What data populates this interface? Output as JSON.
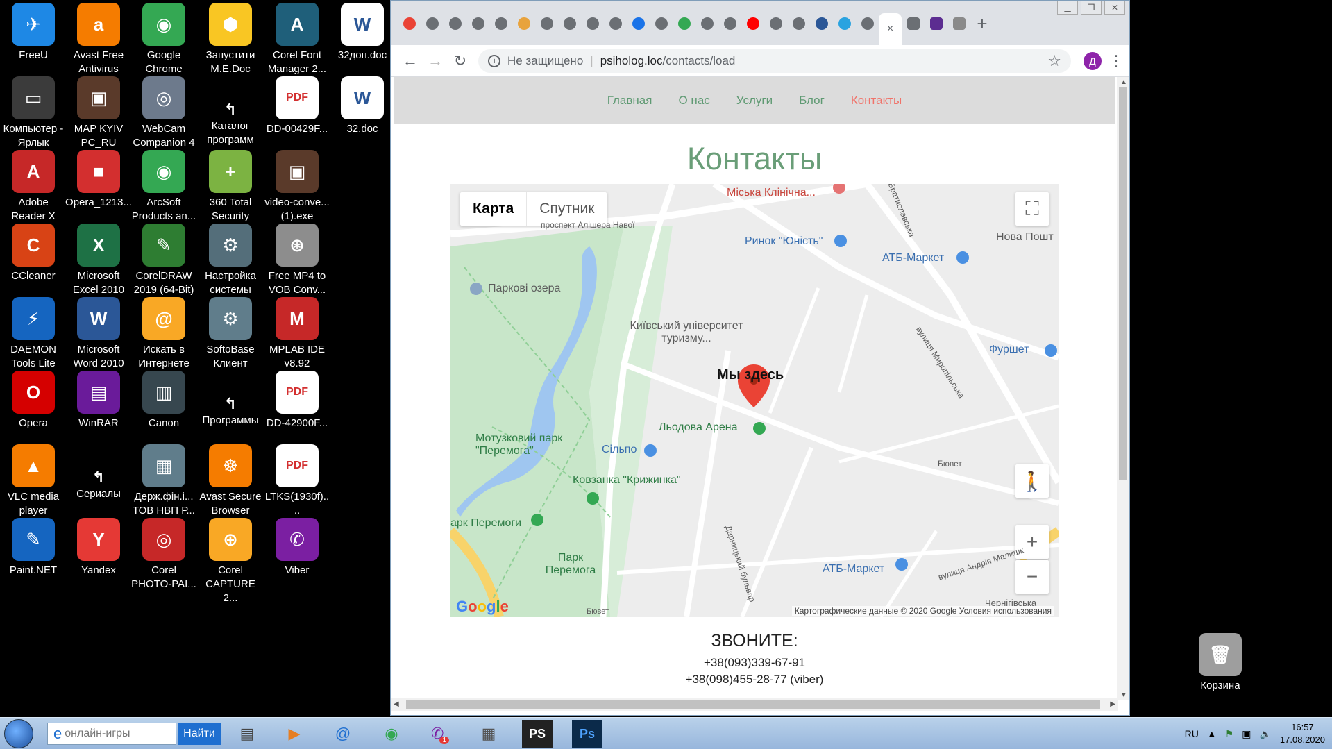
{
  "desktop": {
    "icons": [
      {
        "label": "FreeU",
        "name": "freeu-icon",
        "color": "#1e88e5",
        "glyph": "✈"
      },
      {
        "label": "Avast Free Antivirus",
        "name": "avast-icon",
        "color": "#f57c00",
        "glyph": "a"
      },
      {
        "label": "Google Chrome",
        "name": "chrome-icon",
        "color": "#34a853",
        "glyph": "◉"
      },
      {
        "label": "Запустити M.E.Doc",
        "name": "medoc-icon",
        "color": "#f9c623",
        "glyph": "⬢"
      },
      {
        "label": "Corel Font Manager 2...",
        "name": "corel-font-icon",
        "color": "#1f5f7a",
        "glyph": "A"
      },
      {
        "label": "32доп.doc",
        "name": "word-doc-icon",
        "color": "#2b5797",
        "glyph": "W"
      },
      {
        "label": "Компьютер - Ярлык",
        "name": "computer-icon",
        "color": "#3b3b3b",
        "glyph": "▭"
      },
      {
        "label": "MAP KYIV PC_RU",
        "name": "map-kyiv-icon",
        "color": "#5a3a2a",
        "glyph": "▣"
      },
      {
        "label": "WebCam Companion 4",
        "name": "webcam-icon",
        "color": "#6d7a8c",
        "glyph": "◎"
      },
      {
        "label": "Каталог программ",
        "name": "catalog-icon",
        "color": "#000",
        "glyph": "↰"
      },
      {
        "label": "DD-00429F...",
        "name": "pdf-icon",
        "color": "#d32f2f",
        "glyph": "PDF"
      },
      {
        "label": "32.doc",
        "name": "word-doc2-icon",
        "color": "#2b5797",
        "glyph": "W"
      },
      {
        "label": "Adobe Reader X",
        "name": "adobe-reader-icon",
        "color": "#c62828",
        "glyph": "A"
      },
      {
        "label": "Opera_1213...",
        "name": "opera-setup-icon",
        "color": "#d32f2f",
        "glyph": "■"
      },
      {
        "label": "ArcSoft Products an...",
        "name": "arcsoft-icon",
        "color": "#34a853",
        "glyph": "◉"
      },
      {
        "label": "360 Total Security",
        "name": "360-icon",
        "color": "#7cb342",
        "glyph": "+"
      },
      {
        "label": "video-conve... (1).exe",
        "name": "video-converter-icon",
        "color": "#5a3a2a",
        "glyph": "▣"
      },
      {
        "label": "CCleaner",
        "name": "ccleaner-icon",
        "color": "#d84315",
        "glyph": "C"
      },
      {
        "label": "Microsoft Excel 2010",
        "name": "excel-icon",
        "color": "#1e7145",
        "glyph": "X"
      },
      {
        "label": "CorelDRAW 2019 (64-Bit)",
        "name": "coreldraw-icon",
        "color": "#2e7d32",
        "glyph": "✎"
      },
      {
        "label": "Настройка системы",
        "name": "system-settings-icon",
        "color": "#546e7a",
        "glyph": "⚙"
      },
      {
        "label": "Free MP4 to VOB Conv...",
        "name": "mp4-vob-icon",
        "color": "#8d8d8d",
        "glyph": "⊛"
      },
      {
        "label": "DAEMON Tools Lite",
        "name": "daemon-tools-icon",
        "color": "#1565c0",
        "glyph": "⚡"
      },
      {
        "label": "Microsoft Word 2010",
        "name": "word-icon",
        "color": "#2b5797",
        "glyph": "W"
      },
      {
        "label": "Искать в Интернете",
        "name": "search-internet-icon",
        "color": "#f9a825",
        "glyph": "@"
      },
      {
        "label": "SoftoBase Клиент",
        "name": "softobase-icon",
        "color": "#607d8b",
        "glyph": "⚙"
      },
      {
        "label": "MPLAB IDE v8.92",
        "name": "mplab-icon",
        "color": "#c62828",
        "glyph": "M"
      },
      {
        "label": "Opera",
        "name": "opera-icon",
        "color": "#d50000",
        "glyph": "O"
      },
      {
        "label": "WinRAR",
        "name": "winrar-icon",
        "color": "#6a1b9a",
        "glyph": "▤"
      },
      {
        "label": "Canon",
        "name": "canon-icon",
        "color": "#37474f",
        "glyph": "▥"
      },
      {
        "label": "Программы",
        "name": "programs-icon",
        "color": "#000",
        "glyph": "↰"
      },
      {
        "label": "DD-42900F...",
        "name": "pdf2-icon",
        "color": "#d32f2f",
        "glyph": "PDF"
      },
      {
        "label": "VLC media player",
        "name": "vlc-icon",
        "color": "#f57c00",
        "glyph": "▲"
      },
      {
        "label": "Сериалы",
        "name": "serials-icon",
        "color": "#000",
        "glyph": "↰"
      },
      {
        "label": "Держ.фін.і... ТОВ НВП Р...",
        "name": "folder-doc-icon",
        "color": "#607d8b",
        "glyph": "▦"
      },
      {
        "label": "Avast Secure Browser",
        "name": "avast-browser-icon",
        "color": "#f57c00",
        "glyph": "☸"
      },
      {
        "label": "LTKS(1930f)....",
        "name": "pdf3-icon",
        "color": "#d32f2f",
        "glyph": "PDF"
      },
      {
        "label": "Paint.NET",
        "name": "paintnet-icon",
        "color": "#1565c0",
        "glyph": "✎"
      },
      {
        "label": "Yandex",
        "name": "yandex-icon",
        "color": "#e53935",
        "glyph": "Y"
      },
      {
        "label": "Corel PHOTO-PAI...",
        "name": "corel-photo-icon",
        "color": "#c62828",
        "glyph": "◎"
      },
      {
        "label": "Corel CAPTURE 2...",
        "name": "corel-capture-icon",
        "color": "#f9a825",
        "glyph": "⊕"
      },
      {
        "label": "Viber",
        "name": "viber-icon",
        "color": "#7b1fa2",
        "glyph": "✆"
      },
      {
        "label": "Корзина",
        "name": "recycle-bin-icon",
        "color": "#9e9e9e",
        "glyph": "🗑"
      }
    ]
  },
  "browser": {
    "tab_close": "×",
    "new_tab": "+",
    "omnibox": {
      "security": "Не защищено",
      "host": "psiholog.loc",
      "path": "/contacts/load"
    },
    "profile_initial": "Д"
  },
  "site": {
    "nav": [
      "Главная",
      "О нас",
      "Услуги",
      "Блог",
      "Контакты"
    ],
    "active_nav": "Контакты",
    "title": "Контакты",
    "call_title": "ЗВОНИТЕ:",
    "phone1": "+38(093)339-67-91",
    "phone2": "+38(098)455-28-77 (viber)"
  },
  "map": {
    "type_map": "Карта",
    "type_satellite": "Спутник",
    "marker_label": "Мы здесь",
    "labels": {
      "clinic": "Міська Клінічна...",
      "navoi": "проспект Алішера Навої",
      "bratislavska": "Братиславська",
      "rynok": "Ринок \"Юність\"",
      "atb1": "АТБ-Маркет",
      "nova": "Нова Пошт",
      "parkovi": "Паркові озера",
      "university": "Київський університет туризму...",
      "furshet": "Фуршет",
      "lodova": "Льодова Арена",
      "motuzkovyi": "Мотузковий парк \"Перемога\"",
      "silpo": "Сільпо",
      "kryzhynka": "Ковзанка \"Крижинка\"",
      "bjuvet": "Бювет",
      "park_peremohy": "арк Перемоги",
      "park_peremoha": "Парк Перемога",
      "atb2": "АТБ-Маркет",
      "malyshko": "вулиця Андрія Малишк",
      "chernihivska": "Чернігівська",
      "myropilska": "вулиця Миропільська",
      "darnytskyi": "Дарницький бульвар",
      "bubjuvet2": "Бювет"
    },
    "footer": "Картографические данные © 2020 Google   Условия использования",
    "logo": "Google",
    "zoom_in": "+",
    "zoom_out": "−"
  },
  "taskbar": {
    "search_placeholder": "онлайн-игры",
    "find_button": "Найти",
    "lang": "RU",
    "time": "16:57",
    "date": "17.08.2020",
    "viber_badge": "1"
  }
}
